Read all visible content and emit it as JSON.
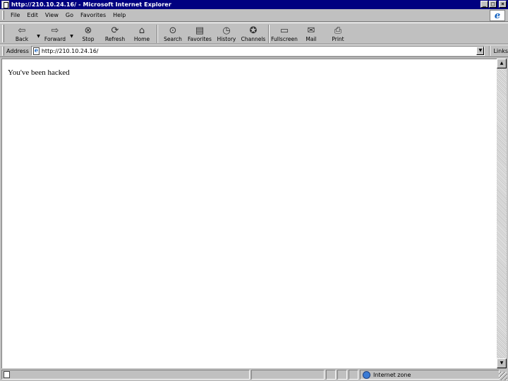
{
  "window": {
    "title": "http://210.10.24.16/ - Microsoft Internet Explorer"
  },
  "window_buttons": {
    "minimize": "_",
    "maximize": "□",
    "close": "×"
  },
  "menu": [
    "File",
    "Edit",
    "View",
    "Go",
    "Favorites",
    "Help"
  ],
  "toolbar": {
    "back": "Back",
    "forward": "Forward",
    "stop": "Stop",
    "refresh": "Refresh",
    "home": "Home",
    "search": "Search",
    "favorites": "Favorites",
    "history": "History",
    "channels": "Channels",
    "fullscreen": "Fullscreen",
    "mail": "Mail",
    "print": "Print"
  },
  "address": {
    "label": "Address",
    "url": "http://210.10.24.16/",
    "links_label": "Links"
  },
  "page": {
    "message": "You've been hacked"
  },
  "status": {
    "zone": "Internet zone"
  },
  "colors": {
    "titlebar": "#000080",
    "chrome": "#c0c0c0",
    "content": "#ffffff"
  },
  "icons": [
    "back-icon",
    "forward-icon",
    "stop-icon",
    "refresh-icon",
    "home-icon",
    "search-icon",
    "favorites-icon",
    "history-icon",
    "channels-icon",
    "fullscreen-icon",
    "mail-icon",
    "print-icon",
    "ie-logo-icon",
    "page-icon",
    "globe-icon"
  ]
}
